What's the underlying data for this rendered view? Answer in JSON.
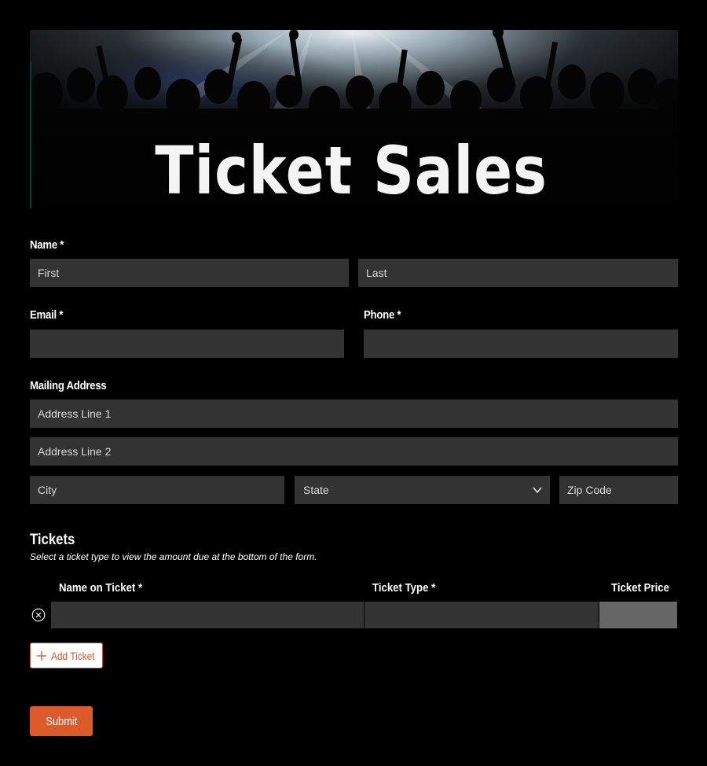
{
  "banner": {
    "title": "Ticket Sales"
  },
  "form": {
    "name": {
      "label": "Name",
      "required_mark": "*",
      "first_placeholder": "First",
      "last_placeholder": "Last"
    },
    "email": {
      "label": "Email",
      "required_mark": "*",
      "placeholder": ""
    },
    "phone": {
      "label": "Phone",
      "required_mark": "*",
      "placeholder": ""
    },
    "address": {
      "label": "Mailing Address",
      "line1_placeholder": "Address Line 1",
      "line2_placeholder": "Address Line 2",
      "city_placeholder": "City",
      "state_selected": "State",
      "zip_placeholder": "Zip Code"
    }
  },
  "tickets": {
    "title": "Tickets",
    "help": "Select a ticket type to view the amount due at the bottom of the form.",
    "columns": {
      "name_on_ticket": "Name on Ticket",
      "ticket_type": "Ticket Type",
      "ticket_price": "Ticket Price",
      "required_mark": "*"
    },
    "rows": [
      {
        "name_on_ticket": "",
        "ticket_type": "",
        "ticket_price": ""
      }
    ],
    "add_label": "Add Ticket"
  },
  "actions": {
    "submit_label": "Submit"
  },
  "colors": {
    "background": "#000000",
    "field": "#333333",
    "price_cell": "#666666",
    "accent": "#dd5a2a"
  },
  "icons": {
    "remove": "circle-x-icon",
    "add": "plus-icon",
    "state_dropdown": "chevron-down-icon"
  }
}
